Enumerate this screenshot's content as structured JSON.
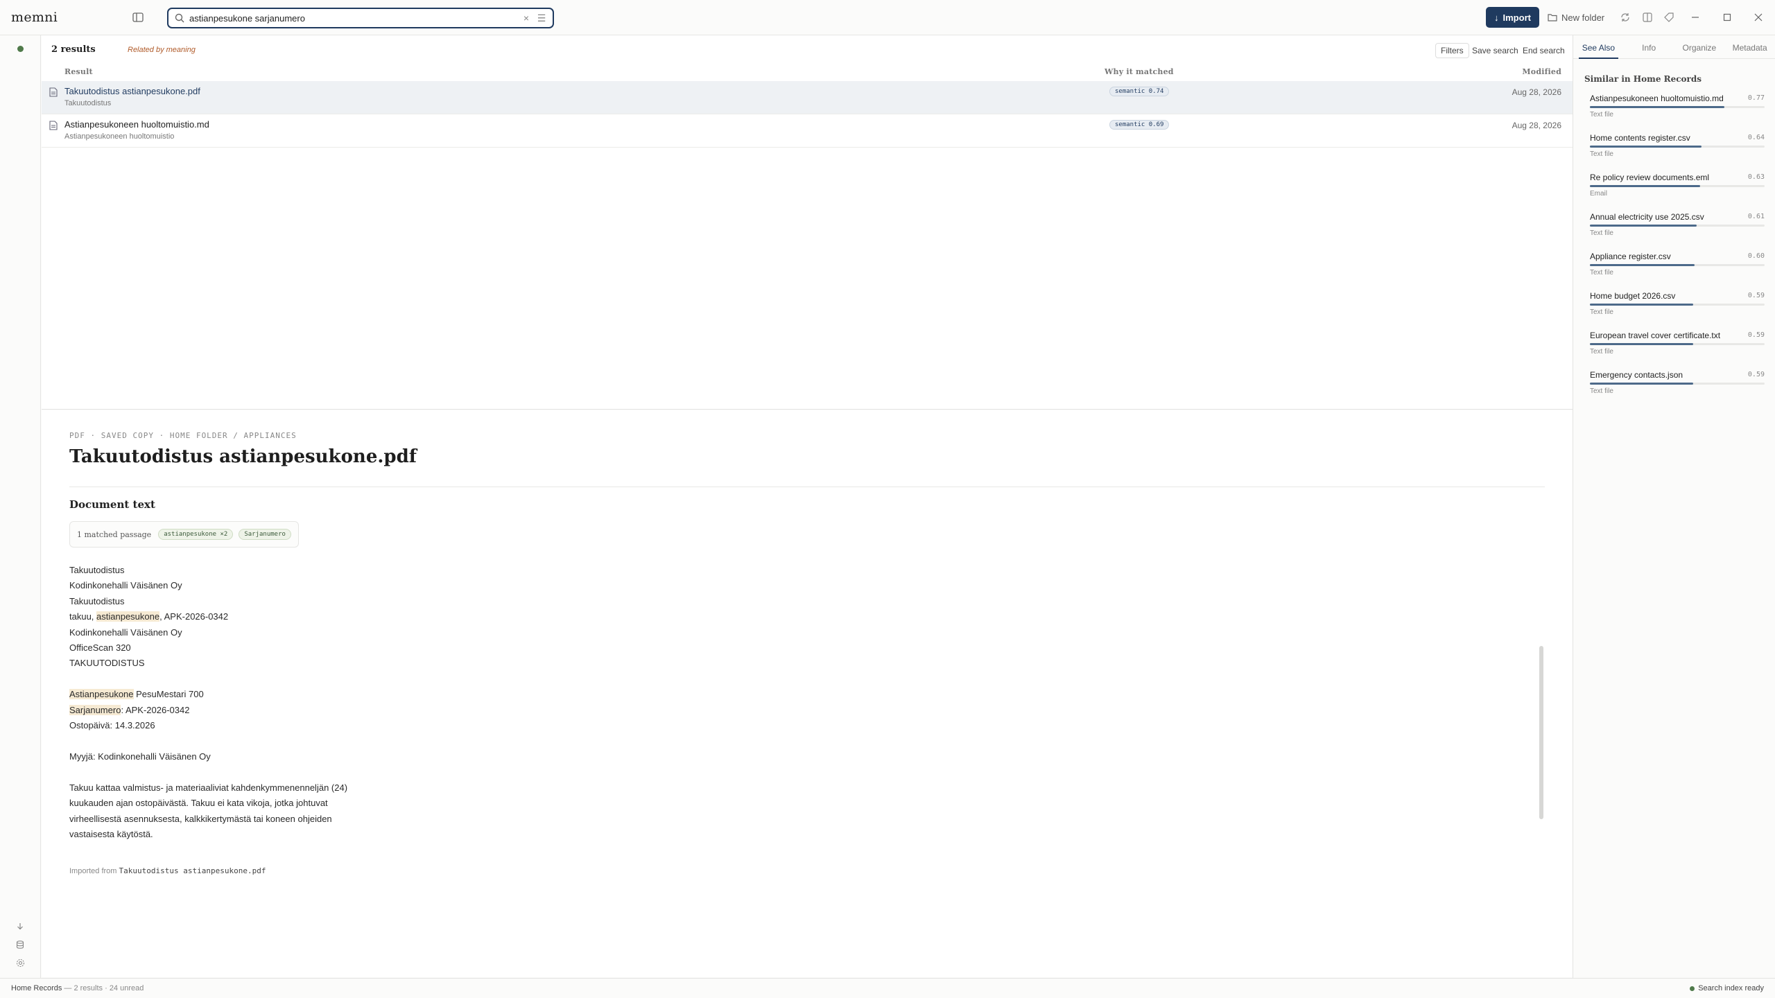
{
  "app": {
    "logo": "memni"
  },
  "search": {
    "value": "astianpesukone sarjanumero",
    "placeholder": ""
  },
  "toolbar": {
    "import_label": "Import",
    "new_folder_label": "New folder"
  },
  "results": {
    "count_label": "2 results",
    "mode_label": "Related by meaning",
    "filters_label": "Filters",
    "save_search_label": "Save search",
    "end_search_label": "End search",
    "columns": {
      "result": "Result",
      "why": "Why it matched",
      "modified": "Modified"
    },
    "rows": [
      {
        "title": "Takuutodistus astianpesukone.pdf",
        "subtitle": "Takuutodistus",
        "badge": "semantic 0.74",
        "date": "Aug 28, 2026"
      },
      {
        "title": "Astianpesukoneen huoltomuistio.md",
        "subtitle": "Astianpesukoneen huoltomuistio",
        "badge": "semantic 0.69",
        "date": "Aug 28, 2026"
      }
    ]
  },
  "preview": {
    "breadcrumb": "PDF · SAVED COPY · HOME FOLDER / APPLIANCES",
    "title": "Takuutodistus astianpesukone.pdf",
    "section_heading": "Document text",
    "matched_label": "1 matched passage",
    "chips": [
      "astianpesukone ×2",
      "Sarjanumero"
    ],
    "lines": {
      "l1": "Takuutodistus",
      "l2": "Kodinkonehalli Väisänen Oy",
      "l3": "Takuutodistus",
      "l4a": "takuu, ",
      "l4b": "astianpesukone",
      "l4c": ", APK-2026-0342",
      "l5": "Kodinkonehalli Väisänen Oy",
      "l6": "OfficeScan 320",
      "l7": "TAKUUTODISTUS",
      "l8a": "Astianpesukone",
      "l8b": " PesuMestari 700",
      "l9a": "Sarjanumero",
      "l9b": ": APK-2026-0342",
      "l10": "Ostopäivä: 14.3.2026",
      "l11": "Myyjä: Kodinkonehalli Väisänen Oy",
      "l12": "Takuu kattaa valmistus- ja materiaaliviat kahdenkymmenenneljän (24)",
      "l13": "kuukauden ajan ostopäivästä. Takuu ei kata vikoja, jotka johtuvat",
      "l14": "virheellisestä asennuksesta, kalkkikertymästä tai koneen ohjeiden",
      "l15": "vastaisesta käytöstä."
    },
    "imported_prefix": "Imported from",
    "imported_file": "Takuutodistus astianpesukone.pdf"
  },
  "panel": {
    "tabs": [
      "See Also",
      "Info",
      "Organize",
      "Metadata"
    ],
    "heading": "Similar in Home Records",
    "items": [
      {
        "name": "Astianpesukoneen huoltomuistio.md",
        "score": "0.77",
        "type": "Text file",
        "level": 0.77
      },
      {
        "name": "Home contents register.csv",
        "score": "0.64",
        "type": "Text file",
        "level": 0.64
      },
      {
        "name": "Re policy review documents.eml",
        "score": "0.63",
        "type": "Email",
        "level": 0.63
      },
      {
        "name": "Annual electricity use 2025.csv",
        "score": "0.61",
        "type": "Text file",
        "level": 0.61
      },
      {
        "name": "Appliance register.csv",
        "score": "0.60",
        "type": "Text file",
        "level": 0.6
      },
      {
        "name": "Home budget 2026.csv",
        "score": "0.59",
        "type": "Text file",
        "level": 0.59
      },
      {
        "name": "European travel cover certificate.txt",
        "score": "0.59",
        "type": "Text file",
        "level": 0.59
      },
      {
        "name": "Emergency contacts.json",
        "score": "0.59",
        "type": "Text file",
        "level": 0.59
      }
    ]
  },
  "status": {
    "library": "Home Records",
    "summary": " — 2 results · 24 unread",
    "index": "Search index ready"
  },
  "colors": {
    "accent": "#1f3a5f",
    "status_green": "#4f7a4a",
    "highlight": "#f6ead3"
  }
}
